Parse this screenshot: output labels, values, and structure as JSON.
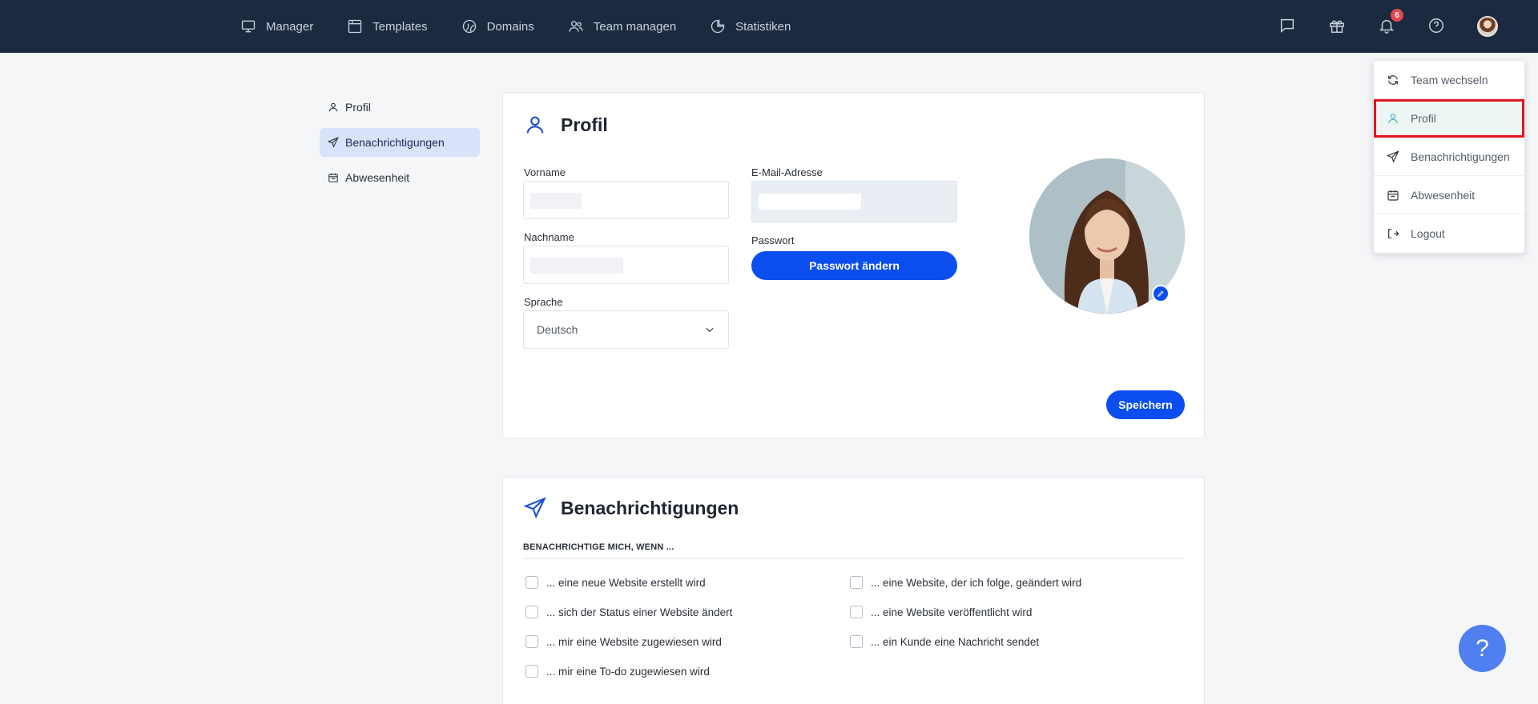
{
  "nav": {
    "items": [
      {
        "label": "Manager",
        "icon": "monitor-icon"
      },
      {
        "label": "Templates",
        "icon": "template-icon"
      },
      {
        "label": "Domains",
        "icon": "globe-icon"
      },
      {
        "label": "Team managen",
        "icon": "team-icon"
      },
      {
        "label": "Statistiken",
        "icon": "pie-chart-icon"
      }
    ],
    "notification_count": "6"
  },
  "sidebar": {
    "items": [
      {
        "label": "Profil",
        "icon": "user-icon"
      },
      {
        "label": "Benachrichtigungen",
        "icon": "send-icon",
        "active": true
      },
      {
        "label": "Abwesenheit",
        "icon": "calendar-icon"
      }
    ]
  },
  "profile": {
    "title": "Profil",
    "firstname_label": "Vorname",
    "lastname_label": "Nachname",
    "email_label": "E-Mail-Adresse",
    "password_label": "Passwort",
    "password_button": "Passwort ändern",
    "language_label": "Sprache",
    "language_value": "Deutsch",
    "save_button": "Speichern"
  },
  "notifications": {
    "title": "Benachrichtigungen",
    "heading": "BENACHRICHTIGE MICH, WENN ...",
    "options_left": [
      "... eine neue Website erstellt wird",
      "... sich der Status einer Website ändert",
      "... mir eine Website zugewiesen wird",
      "... mir eine To-do zugewiesen wird"
    ],
    "options_right": [
      "... eine Website, der ich folge, geändert wird",
      "... eine Website veröffentlicht wird",
      "... ein Kunde eine Nachricht sendet"
    ]
  },
  "dropdown": {
    "items": [
      {
        "label": "Team wechseln",
        "icon": "refresh-icon"
      },
      {
        "label": "Profil",
        "icon": "user-icon",
        "highlighted": true
      },
      {
        "label": "Benachrichtigungen",
        "icon": "send-icon"
      },
      {
        "label": "Abwesenheit",
        "icon": "calendar-icon"
      },
      {
        "label": "Logout",
        "icon": "logout-icon"
      }
    ]
  },
  "help": {
    "label": "?"
  },
  "colors": {
    "topbar": "#1c2a40",
    "primary": "#0b4ef0",
    "highlight_border": "#e0151f"
  }
}
